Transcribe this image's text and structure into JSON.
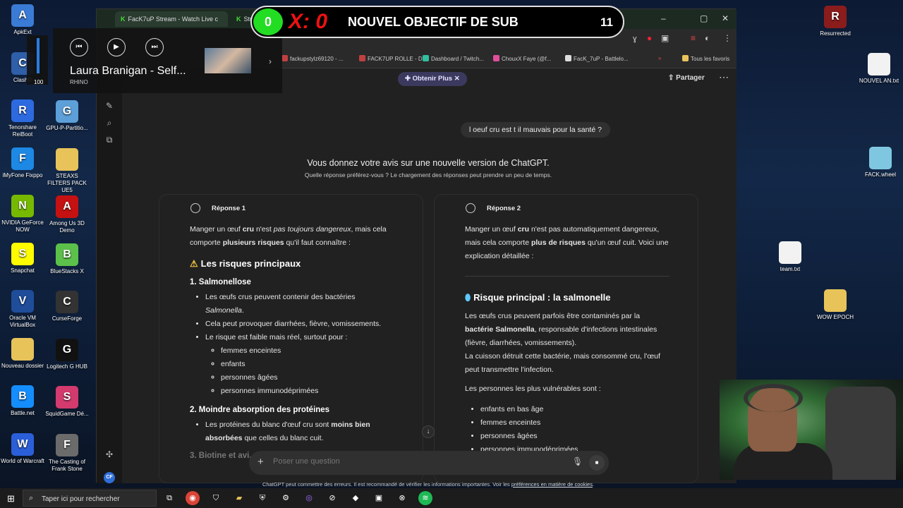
{
  "desktop": {
    "left_icons": [
      {
        "label": "ApkExt",
        "color": "#3a7bd5",
        "glyph": "A"
      },
      {
        "label": "ClashR",
        "color": "#2f5fa8",
        "glyph": "C"
      },
      {
        "label": "Tenorshare ReiBoot",
        "color": "#2d6ae0",
        "glyph": "R"
      },
      {
        "label": "iMyFone Fixppo",
        "color": "#1e88e5",
        "glyph": "F"
      },
      {
        "label": "NVIDIA GeForce NOW",
        "color": "#76b900",
        "glyph": "N"
      },
      {
        "label": "Snapchat",
        "color": "#fffc00",
        "glyph": "S"
      },
      {
        "label": "Oracle VM VirtualBox",
        "color": "#1f4d9a",
        "glyph": "V"
      },
      {
        "label": "Nouveau dossier",
        "color": "#e8c35a",
        "glyph": ""
      },
      {
        "label": "Battle.net",
        "color": "#148eff",
        "glyph": "B"
      },
      {
        "label": "World of Warcraft",
        "color": "#2b5fd9",
        "glyph": "W"
      }
    ],
    "second_icons": [
      {
        "label": "GPU-P-Partitio...",
        "color": "#5d9fd8",
        "glyph": "G"
      },
      {
        "label": "STEAXS FILTERS PACK UE5",
        "color": "#e8c35a",
        "glyph": ""
      },
      {
        "label": "Among Us 3D Demo",
        "color": "#c51111",
        "glyph": "A"
      },
      {
        "label": "BlueStacks X",
        "color": "#5cc14a",
        "glyph": "B"
      },
      {
        "label": "CurseForge",
        "color": "#333333",
        "glyph": "C"
      },
      {
        "label": "Logitech G HUB",
        "color": "#111111",
        "glyph": "G"
      },
      {
        "label": "SquidGame Dé...",
        "color": "#d33a6e",
        "glyph": "S"
      },
      {
        "label": "The Casting of Frank Stone",
        "color": "#6b6b6b",
        "glyph": "F"
      }
    ],
    "right_icons": [
      {
        "label": "Resurrected",
        "color": "#8a1c1c",
        "glyph": "R"
      },
      {
        "label": "NOUVEL AN.txt",
        "color": "#f2f2f2",
        "glyph": ""
      },
      {
        "label": "FACK.wheel",
        "color": "#7fc7e0",
        "glyph": ""
      },
      {
        "label": "team.txt",
        "color": "#f2f2f2",
        "glyph": ""
      },
      {
        "label": "WOW EPOCH",
        "color": "#e8c35a",
        "glyph": ""
      }
    ]
  },
  "browser": {
    "tabs": [
      {
        "label": "FacK7uP Stream - Watch Live c",
        "active": true
      },
      {
        "label": "Stre",
        "active": false
      }
    ],
    "bookmarks": [
      {
        "label": "fackupstylz69120 - ...",
        "color": "#c04040"
      },
      {
        "label": "FACK7UP ROLLE - D...",
        "color": "#c04040"
      },
      {
        "label": "Dashboard / Twitch...",
        "color": "#30c0a0"
      },
      {
        "label": "ChouxX Faye (@f...",
        "color": "#e0509a"
      },
      {
        "label": "FacK_7uP - Battlelo...",
        "color": "#dddddd"
      }
    ],
    "favorites_label": "Tous les favoris"
  },
  "chat": {
    "plus_badge": "Obtenir Plus",
    "share_label": "Partager",
    "user_message": "l oeuf cru est t il mauvais pour la santé ?",
    "compare_title": "Vous donnez votre avis sur une nouvelle version de ChatGPT.",
    "compare_subtitle": "Quelle réponse préférez-vous ? Le chargement des réponses peut prendre un peu de temps.",
    "response1": {
      "title": "Réponse 1",
      "intro_1": "Manger un œuf ",
      "intro_cru": "cru",
      "intro_2": " n'est ",
      "intro_it": "pas toujours dangereux",
      "intro_3": ", mais cela comporte ",
      "intro_bold": "plusieurs risques",
      "intro_4": " qu'il faut connaître :",
      "heading": "Les risques principaux",
      "s1_title": "1. Salmonellose",
      "s1_b1a": "Les œufs crus peuvent contenir des bactéries ",
      "s1_b1it": "Salmonella",
      "s1_b1b": ".",
      "s1_b2": "Cela peut provoquer diarrhées, fièvre, vomissements.",
      "s1_b3": "Le risque est faible mais réel, surtout pour :",
      "s1_sub": [
        "femmes enceintes",
        "enfants",
        "personnes âgées",
        "personnes immunodéprimées"
      ],
      "s2_title": "2. Moindre absorption des protéines",
      "s2_b1a": "Les protéines du blanc d'œuf cru sont ",
      "s2_b1bold": "moins bien absorbées",
      "s2_b1b": " que celles du blanc cuit.",
      "s3_title": "3. Biotine et avi..."
    },
    "response2": {
      "title": "Réponse 2",
      "intro_1": "Manger un œuf ",
      "intro_cru": "cru",
      "intro_2": " n'est pas automatiquement dangereux, mais cela comporte ",
      "intro_bold": "plus de risques",
      "intro_3": " qu'un œuf cuit. Voici une explication détaillée :",
      "heading": "Risque principal : la salmonelle",
      "p1a": "Les œufs crus peuvent parfois être contaminés par la ",
      "p1bold": "bactérie Salmonella",
      "p1b": ", responsable d'infections intestinales (fièvre, diarrhées, vomissements).",
      "p2": "La cuisson détruit cette bactérie, mais consommé cru, l'œuf peut transmettre l'infection.",
      "p3": "Les personnes les plus vulnérables sont :",
      "list": [
        "enfants en bas âge",
        "femmes enceintes",
        "personnes âgées",
        "personnes immunodéprimées"
      ]
    },
    "composer_placeholder": "Poser une question",
    "disclaimer_1": "ChatGPT peut commettre des erreurs. Il est recommandé de vérifier les informations importantes. Voir les ",
    "disclaimer_link": "préférences en matière de cookies",
    "disclaimer_2": ".",
    "avatar_initials": "CF"
  },
  "media": {
    "title": "Laura Branigan - Self...",
    "subtitle": "RHINO",
    "volume": "100"
  },
  "sub_banner": {
    "count": "0",
    "x_text": "X: 0",
    "label": "NOUVEL OBJECTIF DE SUB",
    "target": "11"
  },
  "taskbar": {
    "search_placeholder": "Taper ici pour rechercher"
  }
}
